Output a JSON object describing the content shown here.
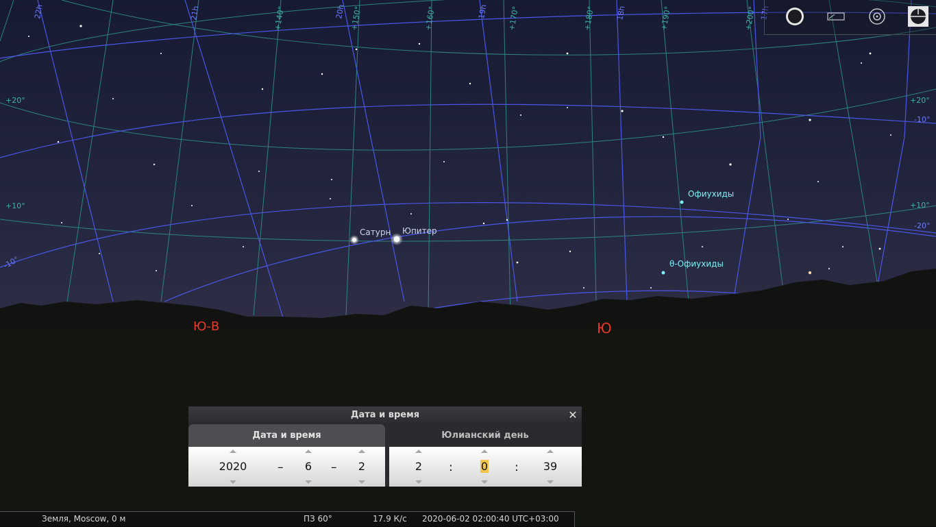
{
  "sky": {
    "planets": [
      {
        "name": "Сатурн"
      },
      {
        "name": "Юпитер"
      }
    ],
    "meteor_showers": [
      {
        "name": "Офиухиды"
      },
      {
        "name": "θ-Офиухиды"
      }
    ],
    "cardinals": {
      "southeast": "Ю-В",
      "south": "Ю"
    },
    "hour_labels": [
      "22h",
      "21h",
      "20h",
      "19h",
      "18h",
      "17h"
    ],
    "longitude_labels": [
      "+140°",
      "+150°",
      "+160°",
      "+170°",
      "+180°",
      "+190°",
      "+200°"
    ],
    "left_dec_labels": [
      "+20°",
      "+10°",
      "-10°"
    ],
    "right_dec_labels": [
      "+20°",
      "-10°",
      "+10°",
      "-20°"
    ],
    "colors": {
      "sky_top": "#161a33",
      "sky_horizon": "#2a2b45",
      "ground": "#121310",
      "equatorial_grid": "#4a57e8",
      "azimuthal_grid": "#2f8f88",
      "cardinal": "#e8382a",
      "shower": "#7ef0f5"
    }
  },
  "toolbar": {
    "buttons": [
      "fullscreen-icon",
      "window-icon",
      "target-icon",
      "grid-icon"
    ]
  },
  "dialog": {
    "title": "Дата и время",
    "close": "✕",
    "tab_date": "Дата и время",
    "tab_julian": "Юлианский день",
    "date": {
      "year": "2020",
      "month": "6",
      "day": "2",
      "sep": "–"
    },
    "time": {
      "hour": "2",
      "minute": "0",
      "second": "39",
      "sep": ":"
    }
  },
  "status": {
    "location": "Земля, Moscow, 0 м",
    "fov": "ПЗ 60°",
    "fps": "17.9 К/с",
    "datetime": "2020-06-02 02:00:40 UTC+03:00"
  }
}
